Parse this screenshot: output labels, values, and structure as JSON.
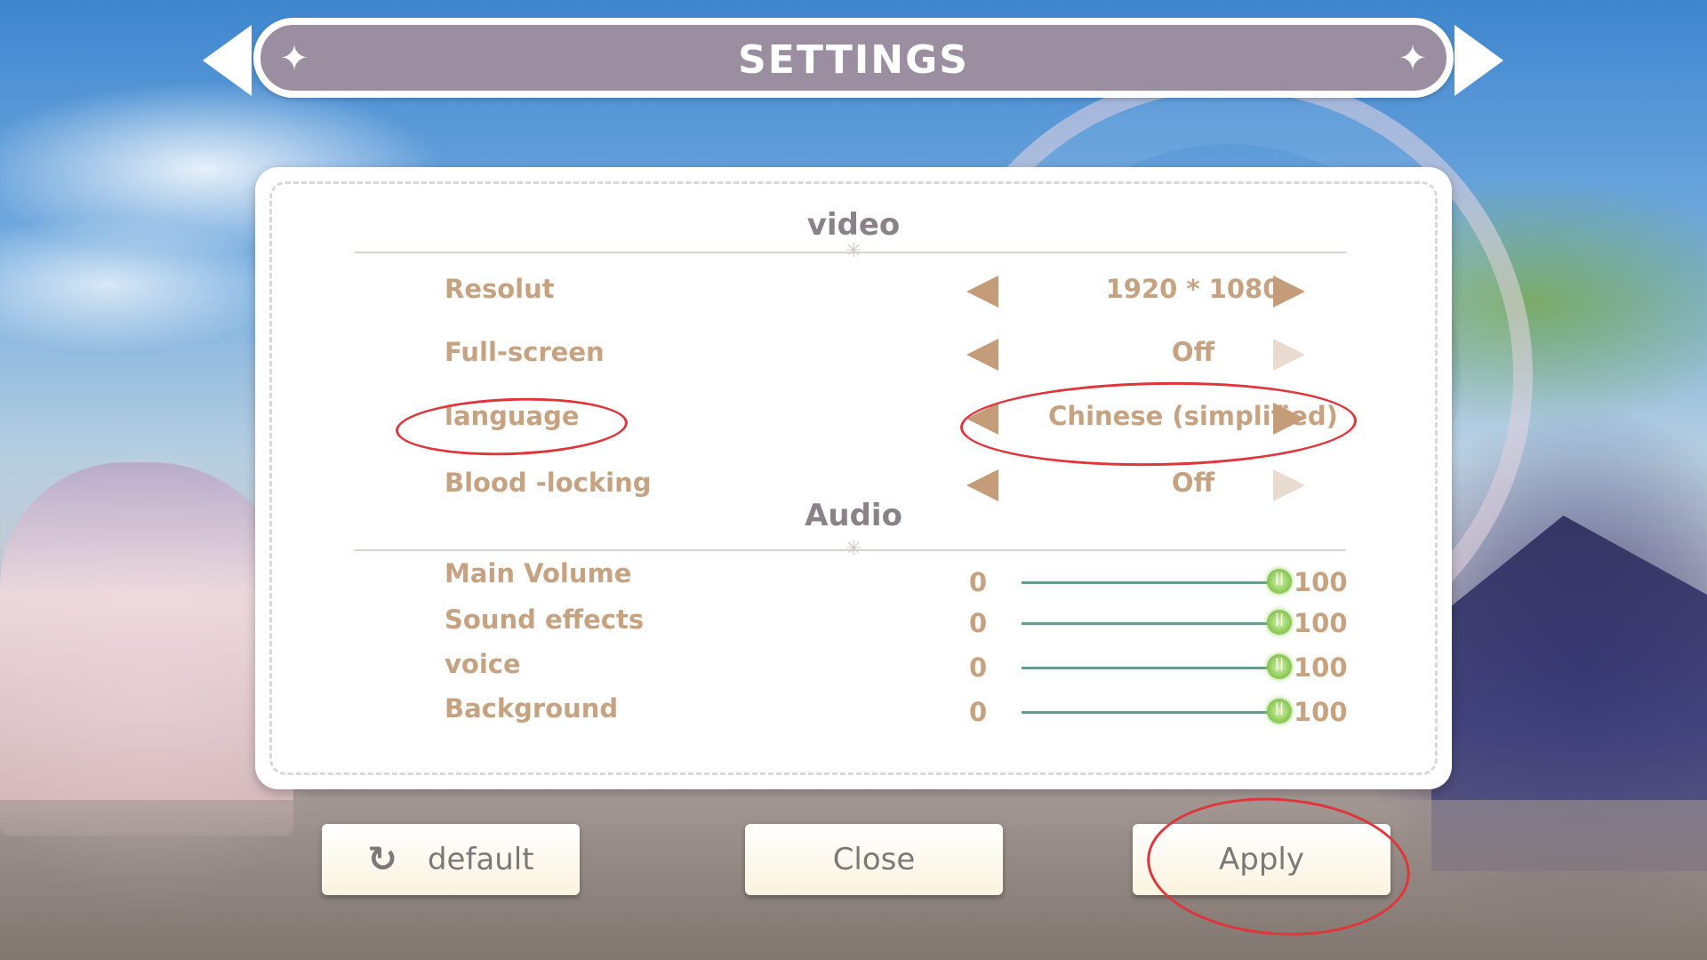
{
  "header": {
    "title": "SETTINGS",
    "star_icon": "sparkle-icon"
  },
  "video": {
    "title": "video",
    "rows": [
      {
        "label": "Resolut",
        "value": "1920 * 1080"
      },
      {
        "label": "Full-screen",
        "value": "Off"
      },
      {
        "label": "language",
        "value": "Chinese (simplified)"
      },
      {
        "label": "Blood -locking",
        "value": "Off"
      }
    ]
  },
  "audio": {
    "title": "Audio",
    "sliders": [
      {
        "label": "Main Volume",
        "min": "0",
        "max": "100",
        "value": 100
      },
      {
        "label": "Sound effects",
        "min": "0",
        "max": "100",
        "value": 100
      },
      {
        "label": "voice",
        "min": "0",
        "max": "100",
        "value": 100
      },
      {
        "label": "Background",
        "min": "0",
        "max": "100",
        "value": 100
      }
    ]
  },
  "buttons": {
    "default": "default",
    "default_icon": "refresh-icon",
    "close": "Close",
    "apply": "Apply"
  },
  "colors": {
    "title_bar": "#9b8ea1",
    "label_text": "#c6a281",
    "arrow": "#c59c79",
    "annotation": "#e0353a",
    "knob": "#8ecb5a"
  }
}
